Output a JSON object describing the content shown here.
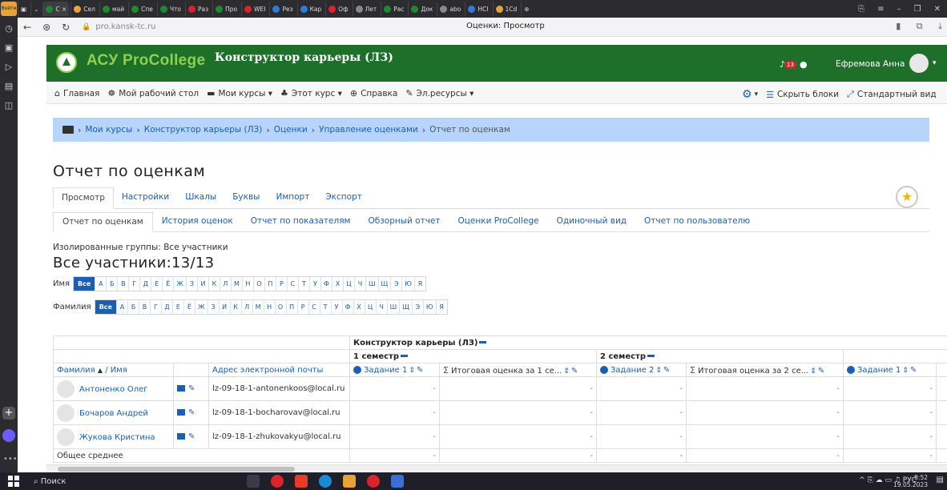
{
  "browser": {
    "login_label": "Войти",
    "tabs": [
      {
        "label": "С ×",
        "color": "#1e8a2e"
      },
      {
        "label": "Сел",
        "color": "#e7a33a"
      },
      {
        "label": "май",
        "color": "#1e8a2e"
      },
      {
        "label": "Спе",
        "color": "#1e8a2e"
      },
      {
        "label": "Что",
        "color": "#1e8a2e"
      },
      {
        "label": "Раз",
        "color": "#d9242b"
      },
      {
        "label": "Про",
        "color": "#1e8a2e"
      },
      {
        "label": "WEI",
        "color": "#d9242b"
      },
      {
        "label": "Рез",
        "color": "#2e7bd9"
      },
      {
        "label": "Кар",
        "color": "#2e7bd9"
      },
      {
        "label": "Оф",
        "color": "#d9242b"
      },
      {
        "label": "Лет",
        "color": "#888888"
      },
      {
        "label": "Рас",
        "color": "#1e8a2e"
      },
      {
        "label": "Док",
        "color": "#1e8a2e"
      },
      {
        "label": "abo",
        "color": "#888888"
      },
      {
        "label": "НСІ",
        "color": "#2e7bd9"
      },
      {
        "label": "1Cd",
        "color": "#e7a33a"
      }
    ],
    "url": "pro.kansk-tc.ru",
    "page_title": "Оценки: Просмотр"
  },
  "header": {
    "brand": "АСУ ProCollege",
    "course_title": "Конструктор карьеры (ЛЗ)",
    "notif_count": "13",
    "username": "Ефремова Анна"
  },
  "navbar": {
    "items": [
      "Главная",
      "Мой рабочий стол",
      "Мои курсы",
      "Этот курс",
      "Справка",
      "Эл.ресурсы"
    ],
    "hide_blocks": "Скрыть блоки",
    "standard_view": "Стандартный вид"
  },
  "breadcrumb": {
    "items": [
      "Мои курсы",
      "Конструктор карьеры (ЛЗ)",
      "Оценки",
      "Управление оценками"
    ],
    "current": "Отчет по оценкам"
  },
  "page": {
    "title": "Отчет по оценкам",
    "tabs1": [
      "Просмотр",
      "Настройки",
      "Шкалы",
      "Буквы",
      "Импорт",
      "Экспорт"
    ],
    "tabs2": [
      "Отчет по оценкам",
      "История оценок",
      "Отчет по показателям",
      "Обзорный отчет",
      "Оценки ProCollege",
      "Одиночный вид",
      "Отчет по пользователю"
    ],
    "groups_label": "Изолированные группы: Все участники",
    "all_count": "Все участники:13/13",
    "first_name_label": "Имя",
    "last_name_label": "Фамилия",
    "all_label": "Все",
    "letters": [
      "А",
      "Б",
      "В",
      "Г",
      "Д",
      "Е",
      "Ё",
      "Ж",
      "З",
      "И",
      "К",
      "Л",
      "М",
      "Н",
      "О",
      "П",
      "Р",
      "С",
      "Т",
      "У",
      "Ф",
      "Х",
      "Ц",
      "Ч",
      "Ш",
      "Щ",
      "Э",
      "Ю",
      "Я"
    ]
  },
  "grid": {
    "course": "Конструктор карьеры (ЛЗ)",
    "sem1": "1 семестр",
    "sem2": "2 семестр",
    "col_surname": "Фамилия",
    "col_name": "/ Имя",
    "col_email": "Адрес электронной почты",
    "col_task1": "Задание 1",
    "col_total1": "Итоговая оценка за 1 се...",
    "col_task2": "Задание 2",
    "col_total2": "Итоговая оценка за 2 се...",
    "col_task1b": "Задание 1",
    "rows": [
      {
        "name": "Антоненко Олег",
        "email": "lz-09-18-1-antonenkoos@local.ru"
      },
      {
        "name": "Бочаров Андрей",
        "email": "lz-09-18-1-bocharovav@local.ru"
      },
      {
        "name": "Жукова Кристина",
        "email": "lz-09-18-1-zhukovakyu@local.ru"
      }
    ],
    "dash": "-",
    "overall": "Общее среднее"
  },
  "taskbar": {
    "search": "Поиск",
    "lang": "РУС",
    "time": "8:52",
    "date": "19.05.2023"
  }
}
